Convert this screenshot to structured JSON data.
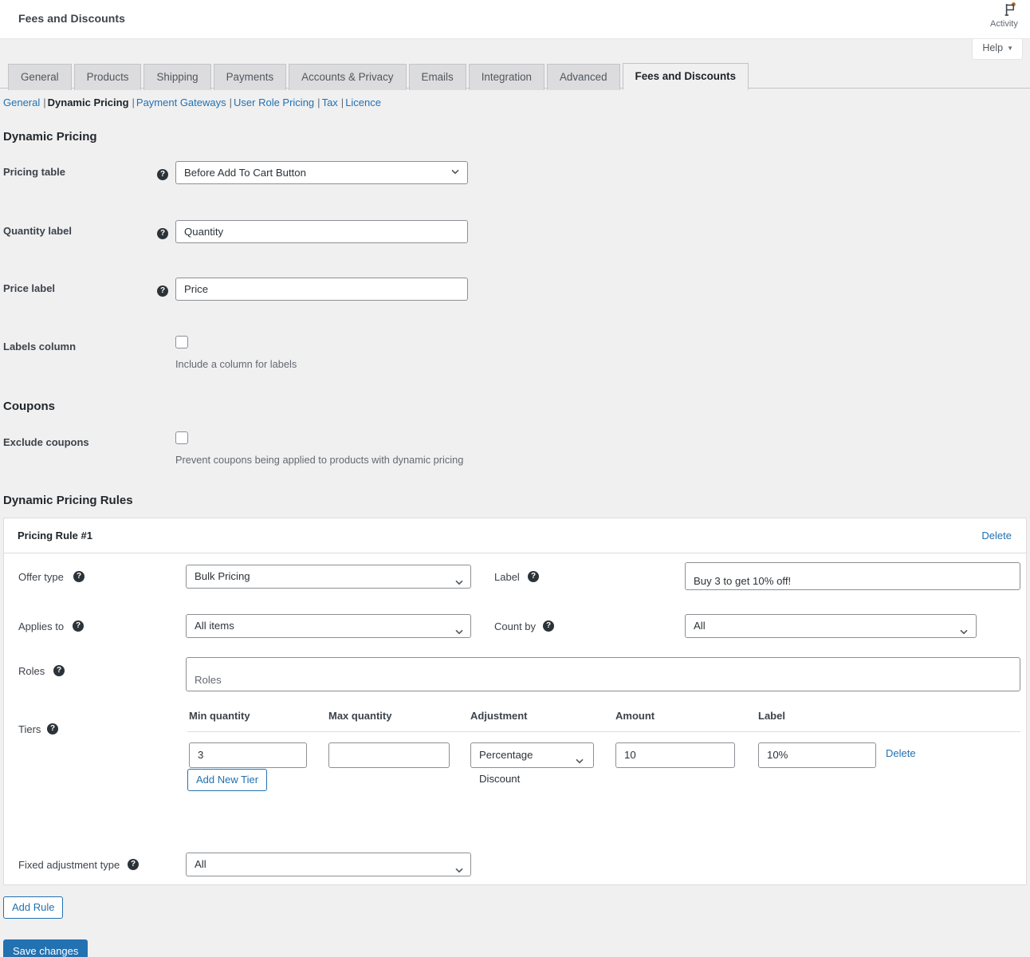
{
  "header": {
    "page_title": "Fees and Discounts",
    "activity_icon": "flag-icon",
    "activity_label": "Activity",
    "help_label": "Help",
    "help_caret": "▼"
  },
  "tabs": [
    {
      "label": "General",
      "active": false
    },
    {
      "label": "Products",
      "active": false
    },
    {
      "label": "Shipping",
      "active": false
    },
    {
      "label": "Payments",
      "active": false
    },
    {
      "label": "Accounts & Privacy",
      "active": false
    },
    {
      "label": "Emails",
      "active": false
    },
    {
      "label": "Integration",
      "active": false
    },
    {
      "label": "Advanced",
      "active": false
    },
    {
      "label": "Fees and Discounts",
      "active": true
    }
  ],
  "subnav": [
    {
      "label": "General",
      "active": false
    },
    {
      "label": "Dynamic Pricing",
      "active": true
    },
    {
      "label": "Payment Gateways",
      "active": false
    },
    {
      "label": "User Role Pricing",
      "active": false
    },
    {
      "label": "Tax",
      "active": false
    },
    {
      "label": "Licence",
      "active": false
    }
  ],
  "dynamic_pricing": {
    "heading": "Dynamic Pricing",
    "pricing_table": {
      "label": "Pricing table",
      "value": "Before Add To Cart Button",
      "help": "?"
    },
    "quantity_label": {
      "label": "Quantity label",
      "value": "Quantity",
      "help": "?"
    },
    "price_label": {
      "label": "Price label",
      "value": "Price",
      "help": "?"
    },
    "labels_column": {
      "label": "Labels column",
      "checked": false,
      "hint": "Include a column for labels"
    }
  },
  "coupons": {
    "heading": "Coupons",
    "exclude_coupons": {
      "label": "Exclude coupons",
      "checked": false,
      "hint": "Prevent coupons being applied to products with dynamic pricing"
    }
  },
  "rules_section": {
    "heading": "Dynamic Pricing Rules",
    "add_rule_label": "Add Rule"
  },
  "rule": {
    "title": "Pricing Rule #1",
    "delete_label": "Delete",
    "offer_type": {
      "label": "Offer type",
      "value": "Bulk Pricing",
      "help": "?"
    },
    "rule_label": {
      "label": "Label",
      "value": "Buy 3 to get 10% off!",
      "help": "?"
    },
    "applies_to": {
      "label": "Applies to",
      "value": "All items",
      "help": "?"
    },
    "count_by": {
      "label": "Count by",
      "value": "All",
      "help": "?"
    },
    "roles": {
      "label": "Roles",
      "placeholder": "Roles",
      "help": "?"
    },
    "tiers": {
      "label": "Tiers",
      "help": "?",
      "columns": [
        "Min quantity",
        "Max quantity",
        "Adjustment",
        "Amount",
        "Label"
      ],
      "rows": [
        {
          "min_quantity": "3",
          "max_quantity": "",
          "adjustment": "Percentage Discount",
          "amount": "10",
          "tier_label": "10%",
          "delete_label": "Delete"
        }
      ],
      "add_tier_label": "Add New Tier"
    },
    "fixed_adjustment_type": {
      "label": "Fixed adjustment type",
      "value": "All",
      "help": "?"
    }
  },
  "footer": {
    "save_label": "Save changes"
  },
  "colors": {
    "accent": "#2271b1",
    "page_bg": "#f0f0f1",
    "card_bg": "#ffffff",
    "border": "#8c8f94",
    "text": "#3c434a",
    "muted": "#646970",
    "badge": "#b5651d"
  }
}
